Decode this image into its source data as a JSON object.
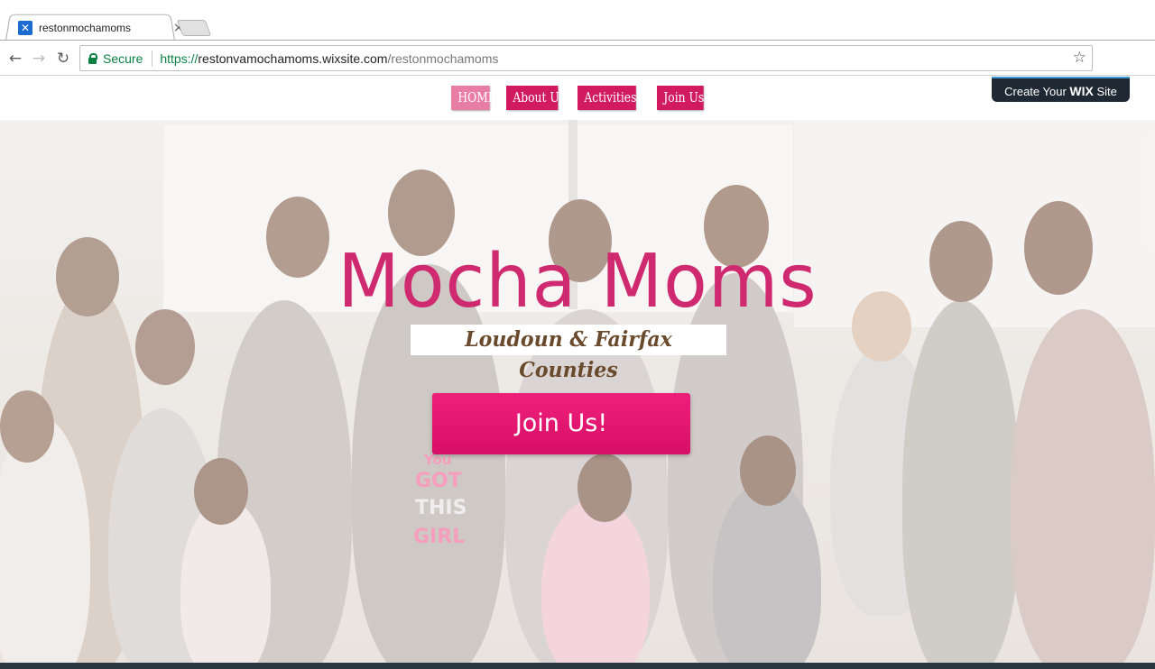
{
  "browser": {
    "tab_title": "restonmochamoms",
    "tab_close": "×",
    "favicon_glyph": "✕",
    "secure_label": "Secure",
    "url_scheme": "https://",
    "url_host": "restonvamochamoms.wixsite.com",
    "url_path": "/restonmochamoms",
    "icons": {
      "back": "←",
      "forward": "→",
      "reload": "↻",
      "bookmark": "☆"
    }
  },
  "site_nav": {
    "items": [
      {
        "label": "HOME",
        "active": true
      },
      {
        "label": "About Us",
        "active": false
      },
      {
        "label": "Activities",
        "active": false
      },
      {
        "label": "Join Us",
        "active": false
      }
    ]
  },
  "wix_badge": {
    "prefix": "Create Your ",
    "brand": "WIX",
    "suffix": " Site"
  },
  "hero": {
    "title": "Mocha Moms",
    "subtitle": "Loudoun & Fairfax Counties",
    "cta_label": "Join Us!",
    "shirt_lines": [
      "You",
      "GOT",
      "THIS",
      "GIRL"
    ]
  },
  "colors": {
    "accent": "#d11a5f",
    "title": "#cf2a6f",
    "subtitle": "#6a4a2c",
    "nav_active": "#e97ea4",
    "badge": "#1f2933"
  }
}
